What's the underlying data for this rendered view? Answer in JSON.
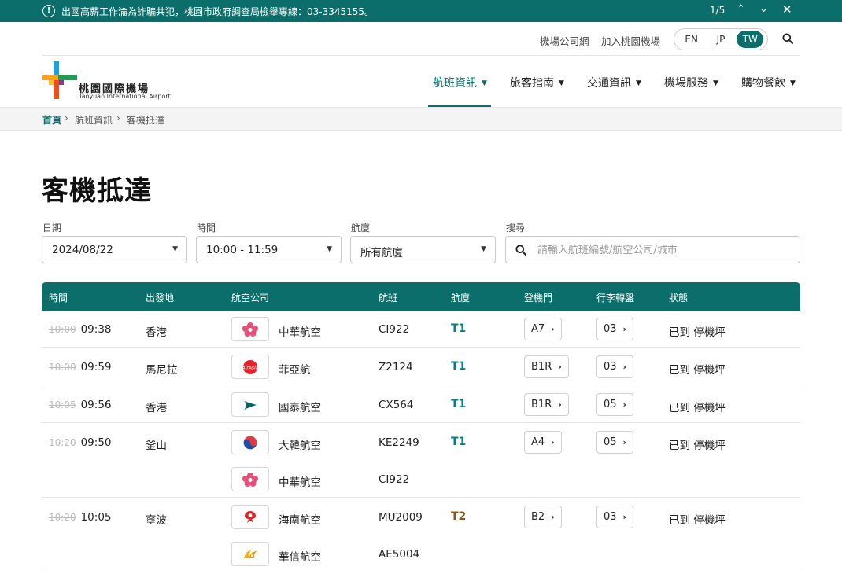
{
  "alert": {
    "icon": "info-circle-icon",
    "text": "出國高薪工作淪為詐騙共犯，桃園市政府調查局檢舉專線：03-3345155。",
    "page": "1/5"
  },
  "utility": {
    "links": [
      "機場公司網",
      "加入桃園機場"
    ],
    "languages": [
      "EN",
      "JP",
      "TW"
    ],
    "active_language": "TW"
  },
  "logo": {
    "name_zh": "桃園國際機場",
    "name_en": "Taoyuan International Airport"
  },
  "nav": {
    "items": [
      "航班資訊",
      "旅客指南",
      "交通資訊",
      "機場服務",
      "購物餐飲"
    ],
    "active": "航班資訊"
  },
  "breadcrumb": [
    "首頁",
    "航班資訊",
    "客機抵達"
  ],
  "page_title": "客機抵達",
  "filters": {
    "date": {
      "label": "日期",
      "value": "2024/08/22"
    },
    "time": {
      "label": "時間",
      "value": "10:00 - 11:59"
    },
    "terminal": {
      "label": "航廈",
      "value": "所有航廈"
    },
    "search": {
      "label": "搜尋",
      "placeholder": "請輸入航班編號/航空公司/城市"
    }
  },
  "table": {
    "headers": [
      "時間",
      "出發地",
      "航空公司",
      "航班",
      "航廈",
      "登機門",
      "行李轉盤",
      "狀態"
    ],
    "rows": [
      {
        "scheduled": "10:00",
        "actual": "09:38",
        "origin": "香港",
        "airline": "中華航空",
        "logo": "china-airlines-plum-logo",
        "flight": "CI922",
        "terminal": "T1",
        "gate": "A7",
        "carousel": "03",
        "status": "已到 停機坪"
      },
      {
        "scheduled": "10:00",
        "actual": "09:59",
        "origin": "馬尼拉",
        "airline": "菲亞航",
        "logo": "airasia-logo",
        "flight": "Z2124",
        "terminal": "T1",
        "gate": "B1R",
        "carousel": "03",
        "status": "已到 停機坪"
      },
      {
        "scheduled": "10:05",
        "actual": "09:56",
        "origin": "香港",
        "airline": "國泰航空",
        "logo": "cathay-brushwing-logo",
        "flight": "CX564",
        "terminal": "T1",
        "gate": "B1R",
        "carousel": "05",
        "status": "已到 停機坪"
      },
      {
        "scheduled": "10:20",
        "actual": "09:50",
        "origin": "釜山",
        "airline": "大韓航空",
        "logo": "korean-air-taeguk-logo",
        "flight": "KE2249",
        "terminal": "T1",
        "gate": "A4",
        "carousel": "05",
        "status": "已到 停機坪"
      },
      {
        "scheduled": "",
        "actual": "",
        "origin": "",
        "airline": "中華航空",
        "logo": "china-airlines-plum-logo",
        "flight": "CI922",
        "terminal": "",
        "gate": "",
        "carousel": "",
        "status": ""
      },
      {
        "scheduled": "10:20",
        "actual": "10:05",
        "origin": "寧波",
        "airline": "海南航空",
        "logo": "hainan-airlines-logo",
        "flight": "MU2009",
        "terminal": "T2",
        "gate": "B2",
        "carousel": "03",
        "status": "已到 停機坪"
      },
      {
        "scheduled": "",
        "actual": "",
        "origin": "",
        "airline": "華信航空",
        "logo": "mandarin-airlines-logo",
        "flight": "AE5004",
        "terminal": "",
        "gate": "",
        "carousel": "",
        "status": ""
      }
    ]
  },
  "colors": {
    "brand_teal": "#0b6e6a",
    "terminal_t1": "#0b7f86",
    "terminal_t2": "#8a5a14"
  }
}
